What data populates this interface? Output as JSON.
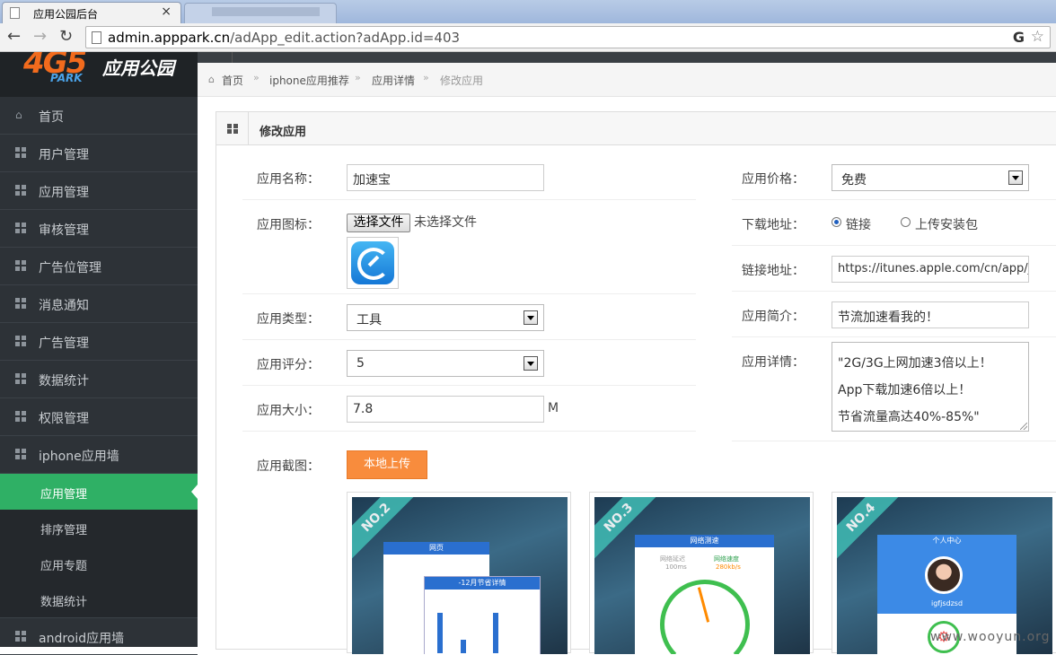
{
  "browser": {
    "active_tab_title": "应用公园后台",
    "url_host": "admin.apppark.cn",
    "url_path": "/adApp_edit.action?adApp.id=403"
  },
  "sidebar": {
    "logo": {
      "number": "4G5",
      "brand": "应用公园",
      "sub": "PARK"
    },
    "items": [
      {
        "label": "首页",
        "icon": "home-icon"
      },
      {
        "label": "用户管理",
        "icon": "grid-icon"
      },
      {
        "label": "应用管理",
        "icon": "grid-icon"
      },
      {
        "label": "审核管理",
        "icon": "grid-icon"
      },
      {
        "label": "广告位管理",
        "icon": "grid-icon"
      },
      {
        "label": "消息通知",
        "icon": "grid-icon"
      },
      {
        "label": "广告管理",
        "icon": "grid-icon"
      },
      {
        "label": "数据统计",
        "icon": "grid-icon"
      },
      {
        "label": "权限管理",
        "icon": "grid-icon"
      },
      {
        "label": "iphone应用墙",
        "icon": "grid-icon"
      }
    ],
    "subitems": [
      {
        "label": "应用管理",
        "active": true
      },
      {
        "label": "排序管理"
      },
      {
        "label": "应用专题"
      },
      {
        "label": "数据统计"
      }
    ],
    "last_item": {
      "label": "android应用墙",
      "icon": "grid-icon"
    }
  },
  "breadcrumb": {
    "home": "首页",
    "b1": "iphone应用推荐",
    "b2": "应用详情",
    "current": "修改应用",
    "sep": "»"
  },
  "panel": {
    "title": "修改应用"
  },
  "form": {
    "name_label": "应用名称：",
    "name_value": "加速宝",
    "icon_label": "应用图标：",
    "file_button": "选择文件",
    "file_status": "未选择文件",
    "type_label": "应用类型：",
    "type_value": "工具",
    "rating_label": "应用评分：",
    "rating_value": "5",
    "size_label": "应用大小：",
    "size_value": "7.8",
    "size_unit": "M",
    "screens_label": "应用截图：",
    "upload_button": "本地上传",
    "price_label": "应用价格：",
    "price_value": "免费",
    "download_label": "下载地址：",
    "radio_link": "链接",
    "radio_package": "上传安装包",
    "link_label": "链接地址：",
    "link_value": "https://itunes.apple.com/cn/app/ji",
    "intro_label": "应用简介：",
    "intro_value": "节流加速看我的！",
    "detail_label": "应用详情：",
    "detail_lines": [
      "\"2G/3G上网加速3倍以上！",
      "App下载加速6倍以上！",
      "节省流量高达40%-85%\""
    ]
  },
  "screenshots": [
    {
      "badge": "NO.2",
      "screen_title": "网页",
      "sub_title": "-12月节省详情"
    },
    {
      "badge": "NO.3",
      "screen_title": "网络测速",
      "metric_a": "网络延迟",
      "metric_b": "网络速度",
      "value_a": "100ms",
      "value_b": "280kb/s"
    },
    {
      "badge": "NO.4",
      "screen_title": "个人中心",
      "user": "igfjsdzsd"
    }
  ],
  "watermark": "www.wooyun.org",
  "colors": {
    "sidebar_bg": "#2d3237",
    "active_green": "#2fb065",
    "upload_orange": "#f88c3d"
  }
}
